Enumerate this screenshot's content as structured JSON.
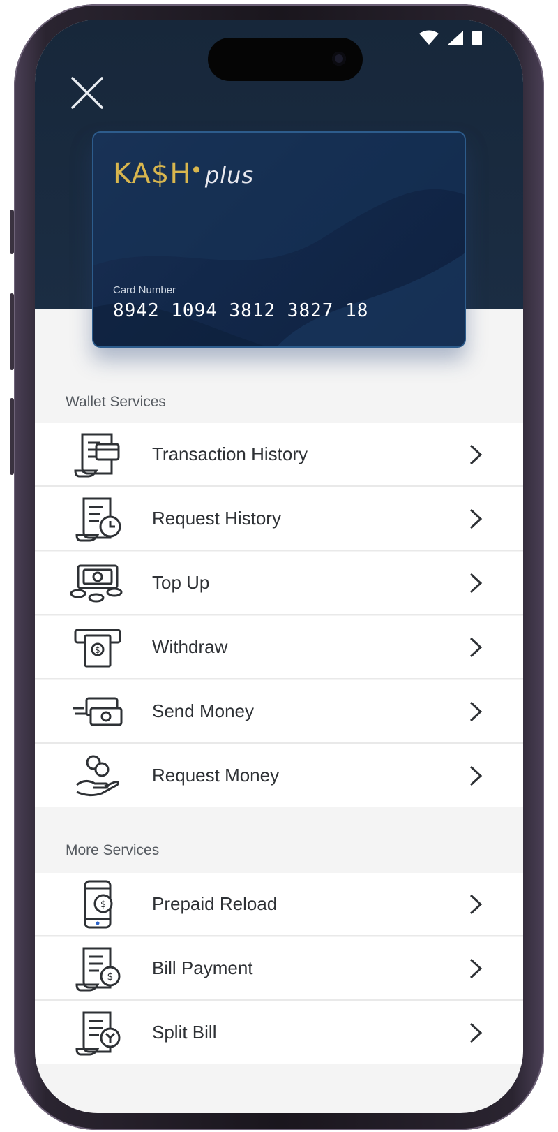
{
  "status_bar": {
    "icons": [
      "wifi-icon",
      "cellular-signal-icon",
      "battery-icon"
    ]
  },
  "header": {
    "close_icon": "close-icon"
  },
  "card": {
    "brand_name": "KA$H",
    "brand_suffix": "plus",
    "number_label": "Card Number",
    "number": "8942 1094 3812 3827 18",
    "colors": {
      "brand_gold": "#d8b64e",
      "card_navy": "#12284a",
      "card_border": "#2d5c8c"
    }
  },
  "wallet_services": {
    "title": "Wallet Services",
    "items": [
      {
        "label": "Transaction History",
        "icon": "transaction-history-icon"
      },
      {
        "label": "Request History",
        "icon": "request-history-icon"
      },
      {
        "label": "Top Up",
        "icon": "top-up-icon"
      },
      {
        "label": "Withdraw",
        "icon": "withdraw-icon"
      },
      {
        "label": "Send Money",
        "icon": "send-money-icon"
      },
      {
        "label": "Request Money",
        "icon": "request-money-icon"
      }
    ]
  },
  "more_services": {
    "title": "More Services",
    "items": [
      {
        "label": "Prepaid Reload",
        "icon": "prepaid-reload-icon"
      },
      {
        "label": "Bill Payment",
        "icon": "bill-payment-icon"
      },
      {
        "label": "Split Bill",
        "icon": "split-bill-icon"
      }
    ]
  },
  "theme": {
    "header_bg": "#17273a",
    "list_bg": "#ffffff",
    "section_bg": "#f4f4f4",
    "text": "#2e3135"
  }
}
